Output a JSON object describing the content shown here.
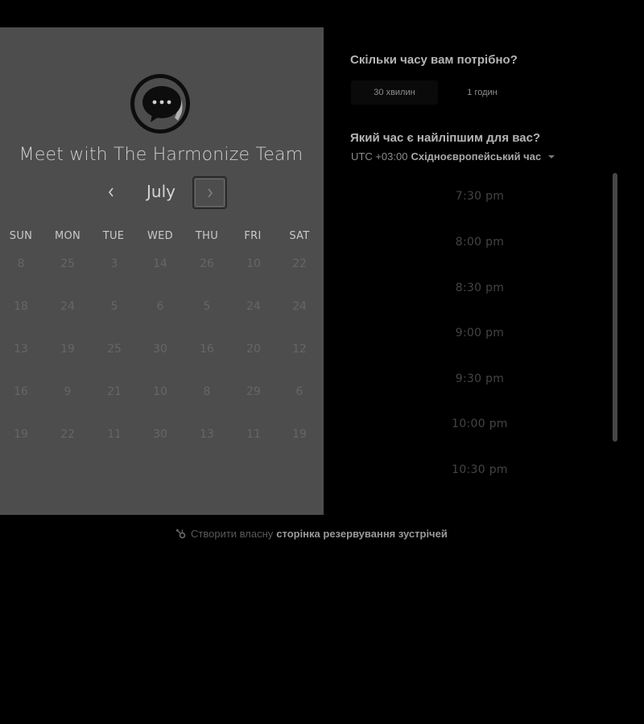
{
  "calendar": {
    "title": "Meet with The Harmonize Team",
    "month": "July",
    "prev_icon": "chevron-left-icon",
    "next_icon": "chevron-right-icon",
    "weekdays": [
      "SUN",
      "MON",
      "TUE",
      "WED",
      "THU",
      "FRI",
      "SAT"
    ],
    "weeks": [
      [
        "8",
        "25",
        "3",
        "14",
        "26",
        "10",
        "22"
      ],
      [
        "18",
        "24",
        "5",
        "6",
        "5",
        "24",
        "24"
      ],
      [
        "13",
        "19",
        "25",
        "30",
        "16",
        "20",
        "12"
      ],
      [
        "16",
        "9",
        "21",
        "10",
        "8",
        "29",
        "6"
      ],
      [
        "19",
        "22",
        "11",
        "30",
        "13",
        "11",
        "19"
      ]
    ]
  },
  "duration": {
    "heading": "Скільки часу вам потрібно?",
    "options": [
      "30 хвилин",
      "1 годин"
    ],
    "selected": "30 хвилин"
  },
  "time": {
    "heading": "Який час є найліпшим для вас?",
    "tz_offset": "UTC +03:00",
    "tz_name": "Східноєвропейський час",
    "slots": [
      "7:30 pm",
      "8:00 pm",
      "8:30 pm",
      "9:00 pm",
      "9:30 pm",
      "10:00 pm",
      "10:30 pm"
    ]
  },
  "footer": {
    "icon": "hubspot-sprocket-icon",
    "text": "Створити власну",
    "link": "сторінка резервування зустрічей"
  },
  "colors": {
    "background": "#000000",
    "calendar_panel": "#4d4d4d"
  }
}
